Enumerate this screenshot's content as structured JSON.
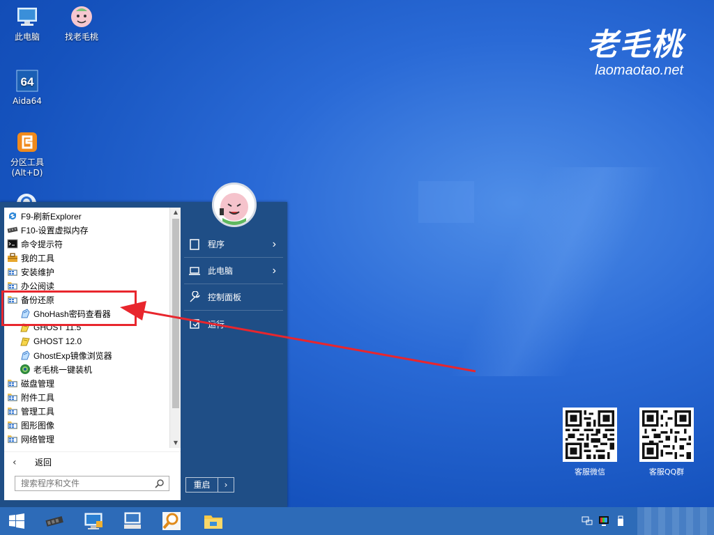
{
  "desktop_icons": [
    {
      "label": "此电脑",
      "icon": "computer-icon"
    },
    {
      "label": "找老毛桃",
      "icon": "peach-mascot-icon"
    },
    {
      "label": "Aida64",
      "icon": "aida64-icon",
      "badge": "64"
    },
    {
      "label": "分区工具\n(Alt+D)",
      "label_line1": "分区工具",
      "label_line2": "(Alt+D)",
      "icon": "partition-tool-icon"
    }
  ],
  "brand": {
    "name": "老毛桃",
    "url": "laomaotao.net"
  },
  "qr_codes": [
    {
      "caption": "客服微信"
    },
    {
      "caption": "客服QQ群"
    }
  ],
  "start_menu": {
    "programs": [
      {
        "label": "F9-刷新Explorer",
        "icon": "refresh-icon",
        "indent": false
      },
      {
        "label": "F10-设置虚拟内存",
        "icon": "memory-chip-icon",
        "indent": false
      },
      {
        "label": "命令提示符",
        "icon": "cmd-icon",
        "indent": false
      },
      {
        "label": "我的工具",
        "icon": "toolbox-icon",
        "indent": false
      },
      {
        "label": "安装维护",
        "icon": "folder-program-icon",
        "indent": false
      },
      {
        "label": "办公阅读",
        "icon": "folder-program-icon",
        "indent": false
      },
      {
        "label": "备份还原",
        "icon": "folder-program-icon",
        "indent": false
      },
      {
        "label": "GhoHash密码查看器",
        "icon": "ghost-app-icon",
        "indent": true
      },
      {
        "label": "GHOST 11.5",
        "icon": "ghost-yellow-icon",
        "indent": true
      },
      {
        "label": "GHOST 12.0",
        "icon": "ghost-yellow-icon",
        "indent": true
      },
      {
        "label": "GhostExp镜像浏览器",
        "icon": "ghost-app-icon",
        "indent": true
      },
      {
        "label": "老毛桃一键装机",
        "icon": "installer-icon",
        "indent": true
      },
      {
        "label": "磁盘管理",
        "icon": "folder-program-icon",
        "indent": false
      },
      {
        "label": "附件工具",
        "icon": "folder-program-icon",
        "indent": false
      },
      {
        "label": "管理工具",
        "icon": "folder-program-icon",
        "indent": false
      },
      {
        "label": "图形图像",
        "icon": "folder-program-icon",
        "indent": false
      },
      {
        "label": "网络管理",
        "icon": "folder-program-icon",
        "indent": false
      }
    ],
    "back_label": "返回",
    "search_placeholder": "搜索程序和文件",
    "right_items": [
      {
        "label": "程序",
        "icon": "document-icon",
        "has_arrow": true
      },
      {
        "label": "此电脑",
        "icon": "laptop-icon",
        "has_arrow": true
      },
      {
        "label": "控制面板",
        "icon": "wrench-icon",
        "has_arrow": false
      },
      {
        "label": "运行...",
        "icon": "run-icon",
        "has_arrow": false
      }
    ],
    "restart_label": "重启",
    "restart_arrow": "›"
  },
  "colors": {
    "menu_bg": "#1f4e86",
    "highlight": "#e8262d",
    "taskbar": "#2d6bb8"
  }
}
